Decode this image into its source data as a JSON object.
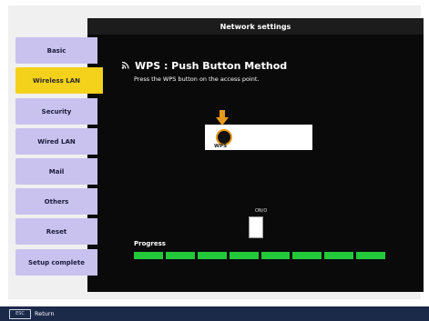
{
  "window": {
    "title": "Network settings"
  },
  "sidebar": {
    "items": [
      {
        "label": "Basic",
        "active": false
      },
      {
        "label": "Wireless LAN",
        "active": true
      },
      {
        "label": "Security",
        "active": false
      },
      {
        "label": "Wired LAN",
        "active": false
      },
      {
        "label": "Mail",
        "active": false
      },
      {
        "label": "Others",
        "active": false
      },
      {
        "label": "Reset",
        "active": false
      },
      {
        "label": "Setup complete",
        "active": false
      }
    ],
    "colors": {
      "normal": "#c9c2ee",
      "active": "#f4d11b"
    }
  },
  "main": {
    "heading": "WPS : Push Button Method",
    "heading_icon": "wireless-icon",
    "instruction": "Press the WPS button on the access point.",
    "wps_label": "WPS",
    "device_label": "ON/O",
    "progress": {
      "label": "Progress",
      "segments_total": 8,
      "segments_filled": 8,
      "fraction": 1.0,
      "color": "#22c93a"
    }
  },
  "footer": {
    "key_label": "ESC",
    "return_label": "Return"
  }
}
